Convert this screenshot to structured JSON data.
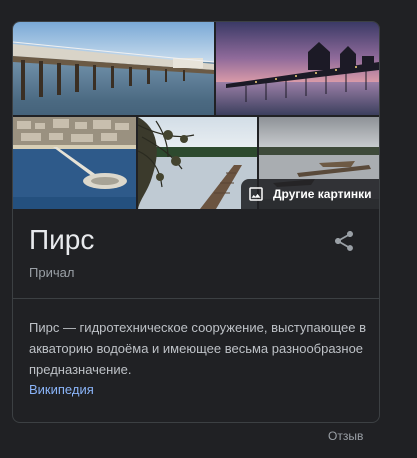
{
  "gallery": {
    "more_images_label": "Другие картинки"
  },
  "entity": {
    "title": "Пирс",
    "subtitle": "Причал"
  },
  "description": {
    "text": "Пирс — гидротехническое сооружение, выступающее в акваторию водоёма и имеющее весьма разнообразное предназначение.",
    "source_link": "Википедия"
  },
  "footer": {
    "feedback_label": "Отзыв"
  },
  "icons": {
    "share": "share-icon",
    "images": "image-icon"
  },
  "colors": {
    "background": "#202124",
    "title_text": "#e8eaed",
    "body_text": "#bdc1c6",
    "muted_text": "#9aa0a6",
    "link": "#8ab4f8",
    "border": "#3c4043"
  }
}
